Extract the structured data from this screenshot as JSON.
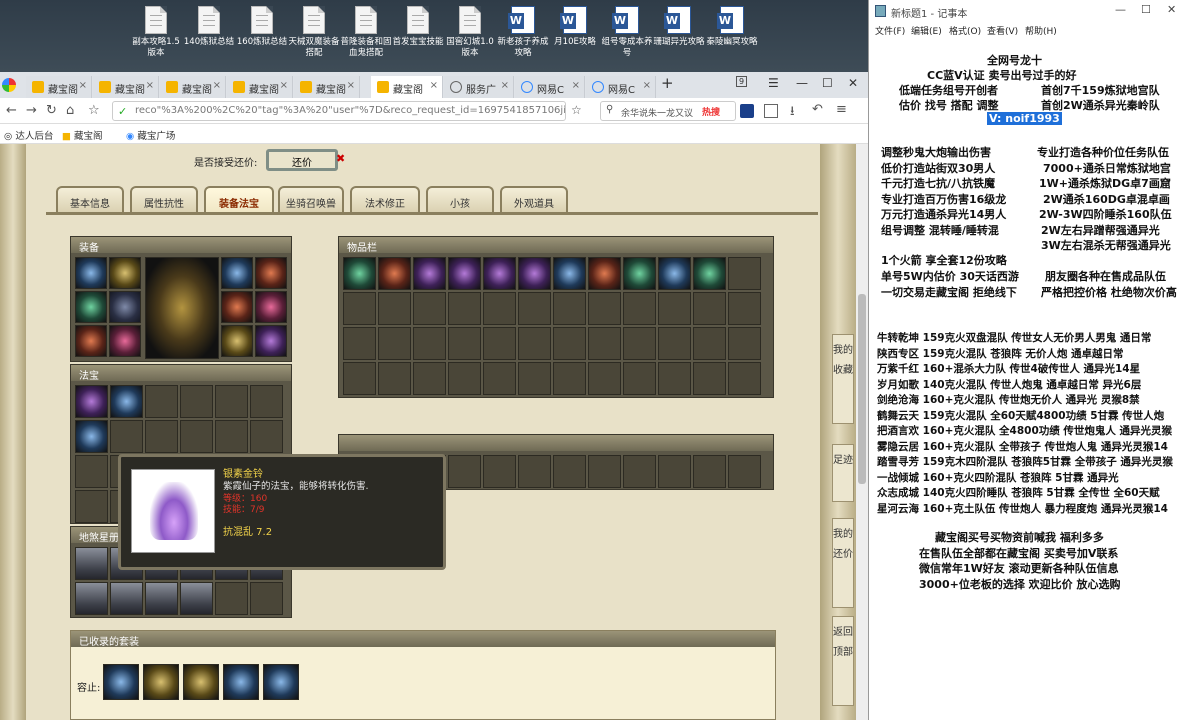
{
  "desktop": {
    "icons": [
      {
        "label": "副本攻略1.5版本",
        "kind": "txt"
      },
      {
        "label": "140炼狱总结",
        "kind": "txt"
      },
      {
        "label": "160炼狱总结",
        "kind": "txt"
      },
      {
        "label": "天械双魔装备搭配",
        "kind": "txt"
      },
      {
        "label": "普隆装备和固血鬼搭配",
        "kind": "txt"
      },
      {
        "label": "首发宝宝技能",
        "kind": "txt"
      },
      {
        "label": "国窖幻城1.0版本",
        "kind": "txt"
      },
      {
        "label": "新老孩子养成攻略",
        "kind": "word"
      },
      {
        "label": "月10E攻略",
        "kind": "word"
      },
      {
        "label": "组号零成本养号",
        "kind": "word"
      },
      {
        "label": "珊瑚异光攻略",
        "kind": "word"
      },
      {
        "label": "秦陵幽冥攻略",
        "kind": "word"
      }
    ]
  },
  "browser": {
    "tabs": [
      "藏宝阁",
      "藏宝阁",
      "藏宝阁",
      "藏宝阁",
      "藏宝阁",
      "藏宝阁",
      "服务广",
      "网易C",
      "网易C"
    ],
    "url": "reco\"%3A%200%2C%20\"tag\"%3A%20\"user\"%7D&reco_request_id=1697541857106jiJMz",
    "search_text": "余华说朱一龙又议",
    "hot_label": "热搜",
    "bookmarks": [
      "达人后台",
      "藏宝阁",
      "藏宝广场"
    ]
  },
  "game": {
    "accept_bargain_label": "是否接受还价:",
    "bargain_value": "还价",
    "tabs": [
      "基本信息",
      "属性抗性",
      "装备法宝",
      "坐骑召唤兽",
      "法术修正",
      "小孩",
      "外观道具"
    ],
    "active_tab": "装备法宝",
    "sections": {
      "equipment": "装备",
      "inventory": "物品栏",
      "treasure": "法宝",
      "star_map": "地煞星册",
      "collected_sets": "已收录的套装",
      "outfit_label": "容止:"
    },
    "side_buttons": [
      "我的收藏",
      "足迹",
      "我的还价",
      "返回顶部"
    ],
    "tooltip": {
      "name": "银素金铃",
      "desc": "紫霞仙子的法宝，能够将转化伤害.",
      "req1": "等级：160",
      "req2": "技能：7/9",
      "stat": "抗混乱 7.2"
    }
  },
  "notepad": {
    "title": "新标题1 - 记事本",
    "menu": [
      "文件(F)",
      "编辑(E)",
      "格式(O)",
      "查看(V)",
      "帮助(H)"
    ],
    "header_lines": [
      "全网号龙十",
      "CC蓝V认证  卖号出号过手的好",
      "低端任务组号开创者",
      "首创7千159炼狱地宫队",
      "估价 找号 搭配 调整",
      "首创2W通杀异光秦岭队",
      "V:  noif1993"
    ],
    "left_col": [
      "调整秒鬼大炮输出伤害",
      "低价打造站街双30男人",
      "千元打造七抗/八抗铁魔",
      "专业打造百万伤害16级龙",
      "万元打造通杀异光14男人",
      "组号调整 混转睡/睡转混",
      "1个火箭 享全套12份攻略",
      "单号5W内估价 30天话西游",
      "一切交易走藏宝阁 拒绝线下"
    ],
    "right_col": [
      "专业打造各种价位任务队伍",
      "7000+通杀日常炼狱地宫",
      "1W+通杀炼狱DG卓7画窟",
      "2W通杀160DG卓混卓画",
      "2W-3W四阶睡杀160队伍",
      "2W左右异蹭帮强通异光",
      "3W左右混杀无帮强通异光",
      "朋友圈各种在售成品队伍",
      "严格把控价格 杜绝物次价高"
    ],
    "team_list": [
      "牛转乾坤 159克火双盘混队 传世女人无价男人男鬼 通日常",
      "陕西专区 159克火混队 苍狼阵 无价人炮 通卓越日常",
      "万紫千红 160+混杀大力队 传世4破传世人 通异光14星",
      "岁月如歌 140克火混队 传世人炮鬼 通卓越日常 异光6层",
      "剑绝沧海 160+克火混队 传世炮无价人 通异光 灵猴8禁",
      "鹤舞云天 159克火混队 全60天赋4800功绩 5甘霖 传世人炮",
      "把酒言欢 160+克火混队 全4800功绩 传世炮鬼人 通异光灵猴",
      "雾隐云居 160+克火混队 全带孩子 传世炮人鬼 通异光灵猴14",
      "踏雪寻芳 159克木四阶混队 苍狼阵5甘霖 全带孩子 通异光灵猴",
      "一战倾城 160+克火四阶混队 苍狼阵 5甘霖 通异光",
      "众志成城 140克火四阶睡队 苍狼阵 5甘霖 全传世 全60天赋",
      "星河云海 160+克土队伍 传世炮人 暴力程度炮 通异光灵猴14"
    ],
    "footer": [
      "藏宝阁买号买物资前喊我 福利多多",
      "在售队伍全部都在藏宝阁 买卖号加V联系",
      "微信常年1W好友 滚动更新各种队伍信息",
      "3000+位老板的选择 欢迎比价 放心选购"
    ]
  }
}
